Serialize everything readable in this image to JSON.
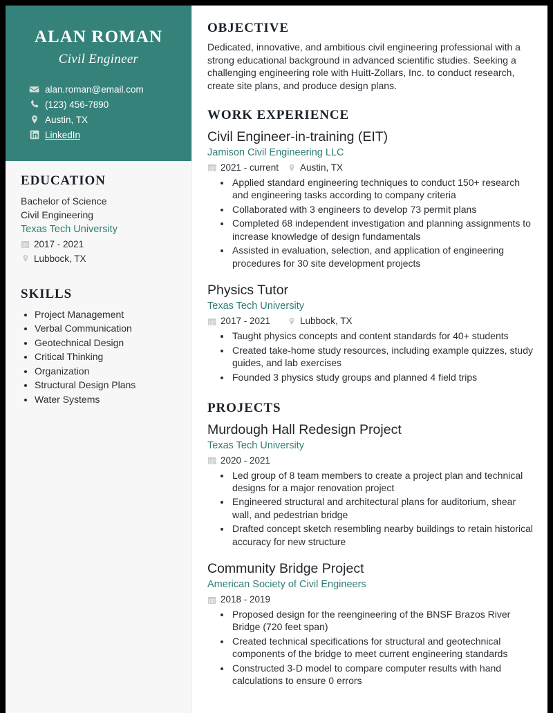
{
  "theme": {
    "header_teal": "#35827a",
    "accent_teal": "#2e7d72",
    "sidebar_bg": "#f7f7f7",
    "text_dark": "#2b2f35",
    "heading_dark": "#1b2129",
    "icon_gray": "#c9ccd0"
  },
  "sidebar": {
    "name": "ALAN ROMAN",
    "job_title": "Civil Engineer",
    "contacts": [
      {
        "icon": "envelope-icon",
        "text": "alan.roman@email.com",
        "link": false
      },
      {
        "icon": "phone-icon",
        "text": "(123) 456-7890",
        "link": false
      },
      {
        "icon": "location-pin-icon",
        "text": "Austin, TX",
        "link": false
      },
      {
        "icon": "linkedin-icon",
        "text": "LinkedIn",
        "link": true
      }
    ],
    "education": {
      "heading": "EDUCATION",
      "degree": "Bachelor of Science",
      "major": "Civil Engineering",
      "school": "Texas Tech University",
      "dates": "2017 - 2021",
      "location": "Lubbock, TX"
    },
    "skills": {
      "heading": "SKILLS",
      "items": [
        "Project Management",
        "Verbal Communication",
        "Geotechnical Design",
        "Critical Thinking",
        "Organization",
        "Structural Design Plans",
        "Water Systems"
      ]
    }
  },
  "main": {
    "objective": {
      "heading": "OBJECTIVE",
      "text": "Dedicated, innovative, and ambitious civil engineering professional with a strong educational background in advanced scientific studies. Seeking a challenging engineering role with Huitt-Zollars, Inc. to conduct research, create site plans, and produce design plans."
    },
    "work_experience": {
      "heading": "WORK EXPERIENCE",
      "entries": [
        {
          "title": "Civil Engineer-in-training (EIT)",
          "org": "Jamison Civil Engineering LLC",
          "dates": "2021 - current",
          "location": "Austin, TX",
          "bullets": [
            "Applied standard engineering techniques to conduct 150+ research and engineering tasks according to company criteria",
            "Collaborated with 3 engineers to develop 73 permit plans",
            "Completed 68 independent investigation and planning assignments to increase knowledge of design fundamentals",
            "Assisted in evaluation, selection, and application of engineering procedures for 30 site development projects"
          ]
        },
        {
          "title": "Physics Tutor",
          "org": "Texas Tech University",
          "dates": "2017 - 2021",
          "location": "Lubbock, TX",
          "bullets": [
            "Taught physics concepts and content standards for 40+ students",
            "Created take-home study resources, including example quizzes, study guides, and lab exercises",
            "Founded 3 physics study groups and planned 4 field trips"
          ]
        }
      ]
    },
    "projects": {
      "heading": "PROJECTS",
      "entries": [
        {
          "title": "Murdough Hall Redesign Project",
          "org": "Texas Tech University",
          "dates": "2020 - 2021",
          "location": "",
          "bullets": [
            "Led group of 8 team members to create a project plan and technical designs for a major renovation project",
            "Engineered structural and architectural plans for auditorium, shear wall, and pedestrian bridge",
            "Drafted concept sketch resembling nearby buildings to retain historical accuracy for new structure"
          ]
        },
        {
          "title": "Community Bridge Project",
          "org": "American Society of Civil Engineers",
          "dates": "2018 - 2019",
          "location": "",
          "bullets": [
            "Proposed design for the reengineering of the BNSF Brazos River Bridge (720 feet span)",
            "Created technical specifications for structural and geotechnical components of the bridge to meet current engineering standards",
            "Constructed 3-D model to compare computer results with hand calculations to ensure 0 errors"
          ]
        }
      ]
    }
  }
}
